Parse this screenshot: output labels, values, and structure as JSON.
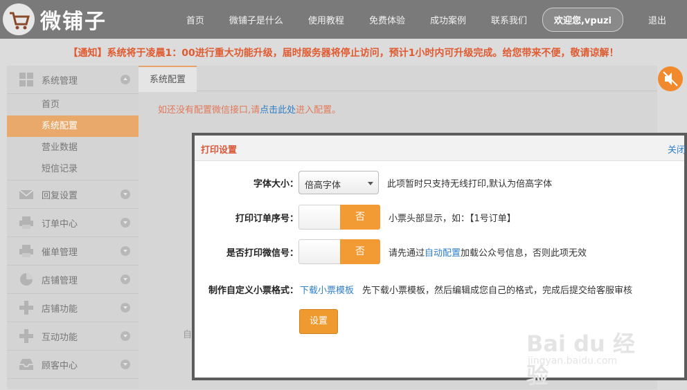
{
  "header": {
    "brand": "微铺子",
    "nav": [
      "首页",
      "微铺子是什么",
      "使用教程",
      "免费体验",
      "成功案例",
      "联系我们"
    ],
    "user": "欢迎您,vpuzi",
    "logout": "退出"
  },
  "notice": "【通知】系统将于凌晨1：00进行重大功能升级，届时服务器将停止访问，预计1小时内可升级完成。给您带来不便，敬请谅解！",
  "sidebar": {
    "groups": [
      {
        "label": "系统管理",
        "icon": "grid-icon"
      },
      {
        "label": "回复设置",
        "icon": "mail-icon"
      },
      {
        "label": "订单中心",
        "icon": "printer-icon"
      },
      {
        "label": "催单管理",
        "icon": "printer-icon"
      },
      {
        "label": "店铺管理",
        "icon": "pie-icon"
      },
      {
        "label": "店铺功能",
        "icon": "plus-icon"
      },
      {
        "label": "互动功能",
        "icon": "plus-icon"
      },
      {
        "label": "顾客中心",
        "icon": "inbox-icon"
      }
    ],
    "subitems": [
      "首页",
      "系统配置",
      "营业数据",
      "短信记录"
    ]
  },
  "main": {
    "tab": "系统配置",
    "hint_prefix": "如还没有配置微信接口,请",
    "hint_link": "点击此处",
    "hint_suffix": "进入配置。",
    "bg_text": "自"
  },
  "modal": {
    "title": "打印设置",
    "close": "关闭",
    "font_size": {
      "label": "字体大小：",
      "value": "倍高字体",
      "desc": "此项暂时只支持无线打印,默认为倍高字体"
    },
    "print_order_no": {
      "label": "打印订单序号：",
      "toggle": "否",
      "desc": "小票头部显示，如：【1号订单】"
    },
    "print_wechat": {
      "label": "是否打印微信号：",
      "toggle": "否",
      "desc_prefix": "请先通过",
      "desc_link": "自动配置",
      "desc_suffix": "加载公众号信息，否则此项无效"
    },
    "custom_format": {
      "label": "制作自定义小票格式：",
      "link": "下载小票模板",
      "desc": "先下载小票模板，然后编辑成您自己的格式，完成后提交给客服审核"
    },
    "submit": "设置"
  },
  "watermark": {
    "text": "Bai du 经验",
    "sub": "jingyan.baidu.com"
  },
  "colors": {
    "accent": "#f29a34",
    "notice": "#e05a30",
    "link": "#2f7fc8",
    "header": "#7a7a7a"
  }
}
